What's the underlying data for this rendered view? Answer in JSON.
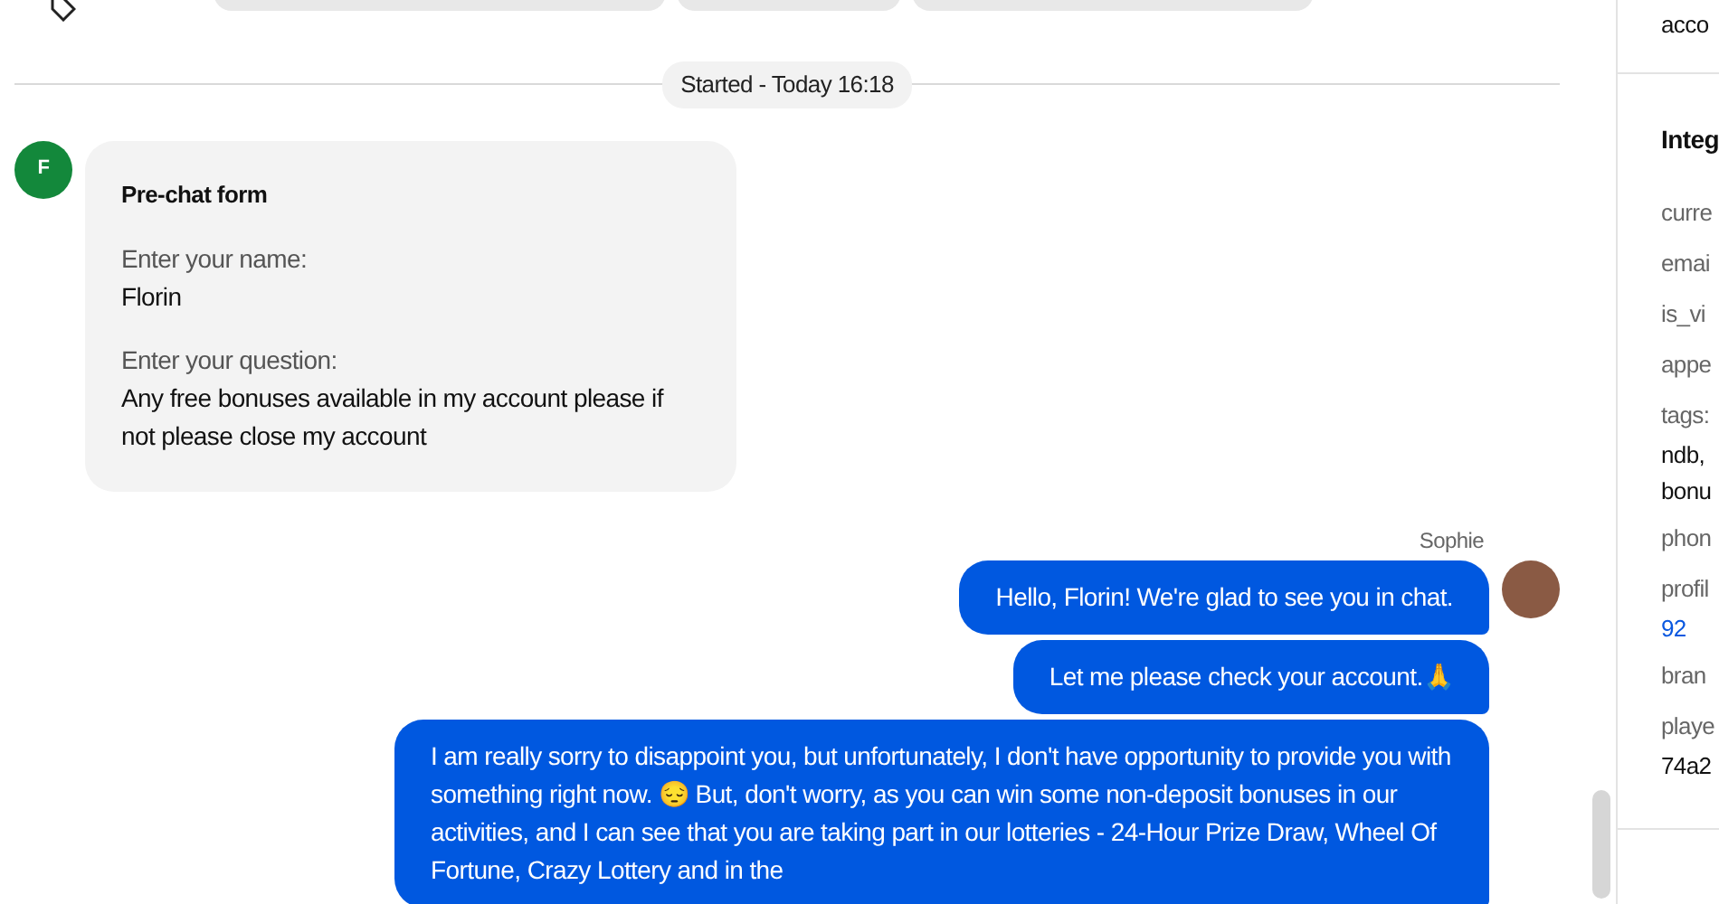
{
  "tag_row": {
    "tags": [
      {
        "kind": "pill"
      },
      {
        "kind": "pill"
      },
      {
        "kind": "pill"
      }
    ]
  },
  "chat": {
    "divider": "Started - Today 16:18",
    "prechat": {
      "avatar": "F",
      "title": "Pre-chat form",
      "fields": [
        {
          "label": "Enter your name:",
          "value": "Florin"
        },
        {
          "label": "Enter your question:",
          "value": "Any free bonuses available in my account please if not please close my account"
        }
      ]
    },
    "agent": {
      "name": "Sophie",
      "messages": [
        "Hello, Florin! We're glad to see you in chat.",
        "Let me please check your account.🙏",
        "I am really sorry to disappoint you, but unfortunately, I don't have opportunity to provide you with something right now. 😔 But, don't worry, as you can win some non-deposit bonuses in our activities, and I can see that you are taking part in our lotteries - 24-Hour Prize Draw, Wheel Of Fortune, Crazy Lottery and in the"
      ]
    }
  },
  "side_panel": {
    "top_value": "acco",
    "section_title": "Integ",
    "rows": [
      {
        "kind": "label",
        "text": "curre"
      },
      {
        "kind": "label",
        "text": "emai"
      },
      {
        "kind": "label",
        "text": "is_vi"
      },
      {
        "kind": "label",
        "text": "appe"
      },
      {
        "kind": "label",
        "text": "tags:"
      },
      {
        "kind": "value",
        "text": "ndb,"
      },
      {
        "kind": "value",
        "text": "bonu"
      },
      {
        "kind": "label",
        "text": "phon"
      },
      {
        "kind": "label",
        "text": "profil"
      },
      {
        "kind": "link",
        "text": "92"
      },
      {
        "kind": "label",
        "text": "bran"
      },
      {
        "kind": "label",
        "text": "playe"
      },
      {
        "kind": "value",
        "text": "74a2"
      }
    ]
  }
}
